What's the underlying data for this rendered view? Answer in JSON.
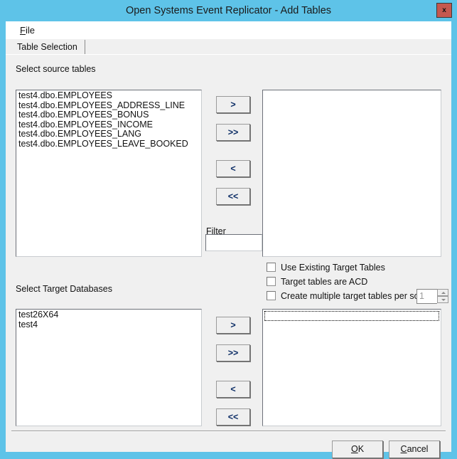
{
  "window": {
    "title": "Open Systems Event Replicator - Add Tables",
    "close_label": "x",
    "titlebar_color": "#5ec3e8",
    "accent_close_color": "#c5584f"
  },
  "menu": {
    "items": [
      {
        "label_before": "",
        "accel": "F",
        "label_after": "ile"
      }
    ]
  },
  "tabs": [
    {
      "label": "Table Selection",
      "selected": true
    }
  ],
  "source_section": {
    "label": "Select source tables",
    "tables": [
      "test4.dbo.EMPLOYEES",
      "test4.dbo.EMPLOYEES_ADDRESS_LINE",
      "test4.dbo.EMPLOYEES_BONUS",
      "test4.dbo.EMPLOYEES_INCOME",
      "test4.dbo.EMPLOYEES_LANG",
      "test4.dbo.EMPLOYEES_LEAVE_BOOKED"
    ],
    "selected_tables": []
  },
  "filter": {
    "label": "Filter",
    "value": "",
    "placeholder": ""
  },
  "transfer_buttons_top": [
    {
      "label": ">",
      "name": "move-right"
    },
    {
      "label": ">>",
      "name": "move-all-right"
    },
    {
      "label": "<",
      "name": "move-left"
    },
    {
      "label": "<<",
      "name": "move-all-left"
    }
  ],
  "options": {
    "checkboxes": [
      {
        "label": "Use Existing Target Tables",
        "checked": false
      },
      {
        "label": "Target tables are ACD",
        "checked": false
      },
      {
        "label": "Create multiple target tables per source",
        "checked": false
      }
    ],
    "multiplier": {
      "value": "1",
      "enabled": false
    }
  },
  "target_section": {
    "label": "Select Target Databases",
    "databases": [
      "test26X64",
      "test4"
    ],
    "selected_databases": []
  },
  "transfer_buttons_bottom": [
    {
      "label": ">",
      "name": "move-right"
    },
    {
      "label": ">>",
      "name": "move-all-right"
    },
    {
      "label": "<",
      "name": "move-left"
    },
    {
      "label": "<<",
      "name": "move-all-left"
    }
  ],
  "dialog_buttons": {
    "ok": {
      "accel": "O",
      "rest": "K"
    },
    "cancel": {
      "accel": "C",
      "rest": "ancel"
    }
  }
}
